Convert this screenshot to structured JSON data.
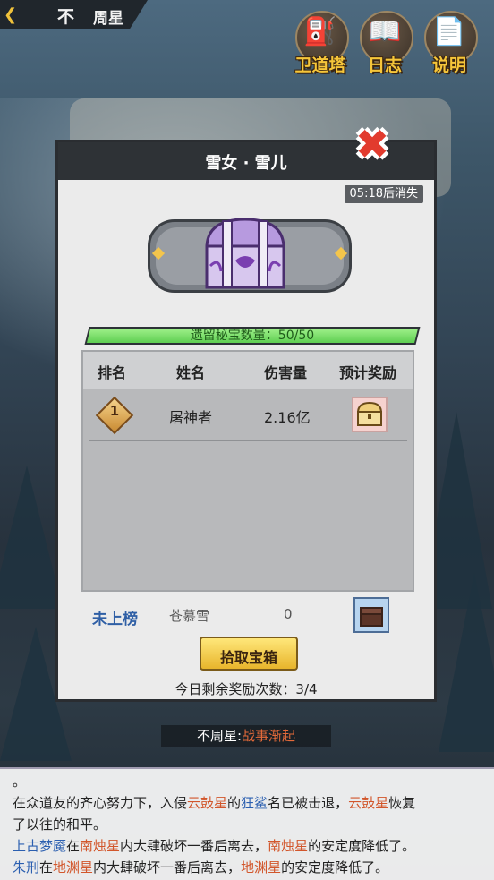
{
  "topbar": {
    "title": "周星",
    "logo": "不"
  },
  "top_buttons": [
    {
      "label": "卫道塔",
      "icon": "tower-icon"
    },
    {
      "label": "日志",
      "icon": "book-icon"
    },
    {
      "label": "说明",
      "icon": "document-icon"
    }
  ],
  "popup": {
    "title": "雪女 · 雪儿",
    "timer": "05:18后消失",
    "treasure_count": "遗留秘宝数量：50/50",
    "treasure_progress": 1.0,
    "table": {
      "headers": [
        "排名",
        "姓名",
        "伤害量",
        "预计奖励"
      ],
      "rows": [
        {
          "rank": "1",
          "name": "屠神者",
          "damage": "2.16亿"
        }
      ]
    },
    "my_row": {
      "rank": "未上榜",
      "name": "苍慕雪",
      "damage": "0"
    },
    "claim_button": "拾取宝箱",
    "remaining": "今日剩余奖励次数：3/4"
  },
  "bottom": {
    "prefix": "不周星:",
    "event": "战事渐起"
  },
  "log_lines": [
    [
      {
        "t": "。"
      }
    ],
    [
      {
        "t": "在众道友的齐心努力下，入侵"
      },
      {
        "t": "云鼓星",
        "c": "r"
      },
      {
        "t": "的"
      },
      {
        "t": "狂鲨",
        "c": "b"
      },
      {
        "t": "名已被击退，"
      },
      {
        "t": "云鼓星",
        "c": "r"
      },
      {
        "t": "恢复"
      }
    ],
    [
      {
        "t": "了以往的和平。"
      }
    ],
    [
      {
        "t": "上古梦魇",
        "c": "b"
      },
      {
        "t": "在"
      },
      {
        "t": "南烛星",
        "c": "r"
      },
      {
        "t": "内大肆破坏一番后离去，"
      },
      {
        "t": "南烛星",
        "c": "r"
      },
      {
        "t": "的安定度降低了。"
      }
    ],
    [
      {
        "t": "朱刑",
        "c": "b"
      },
      {
        "t": "在"
      },
      {
        "t": "地渊星",
        "c": "r"
      },
      {
        "t": "内大肆破坏一番后离去，"
      },
      {
        "t": "地渊星",
        "c": "r"
      },
      {
        "t": "的安定度降低了。"
      }
    ]
  ]
}
